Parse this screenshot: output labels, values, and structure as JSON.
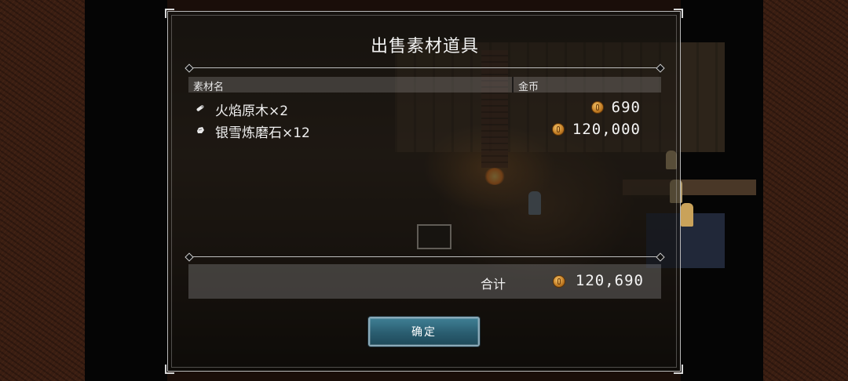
{
  "dialog": {
    "title": "出售素材道具",
    "table": {
      "col_name": "素材名",
      "col_gold": "金币"
    },
    "items": [
      {
        "name": "火焰原木×2",
        "icon": "log-item-icon",
        "price": "690"
      },
      {
        "name": "银雪炼磨石×12",
        "icon": "stone-item-icon",
        "price": "120,000"
      }
    ],
    "total_label": "合计",
    "total_value": "120,690",
    "confirm_label": "确定"
  },
  "colors": {
    "button_fill": "#2a5d70",
    "coin": "#c07a22"
  }
}
